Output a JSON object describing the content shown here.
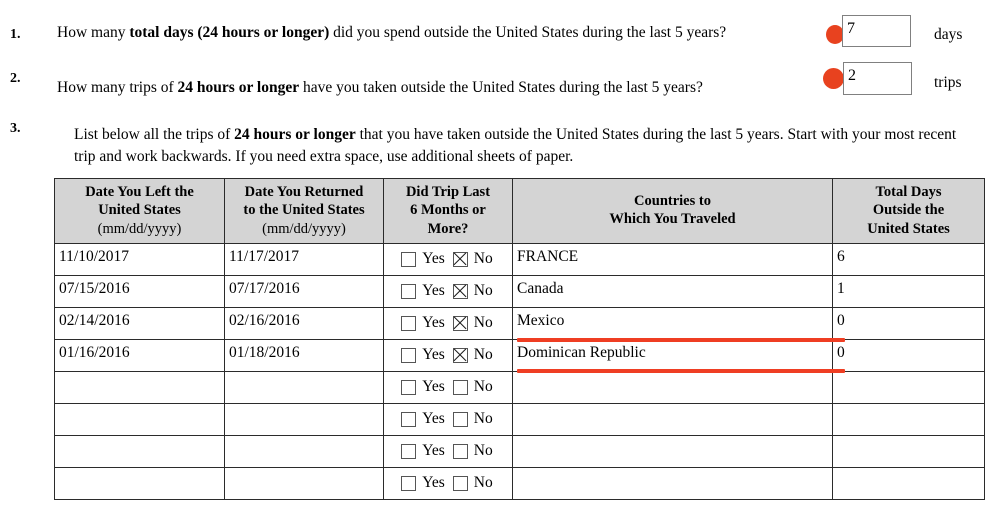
{
  "form": {
    "questions": [
      {
        "number": "1.",
        "text_before": "How many ",
        "text_bold": "total days (24 hours or longer)",
        "text_after": " did you spend outside the United States during the last 5 years?",
        "answer_value": "7",
        "unit": "days"
      },
      {
        "number": "2.",
        "text_before": "How many trips of ",
        "text_bold": "24 hours or longer",
        "text_after": " have you taken outside the United States during the last 5 years?",
        "answer_value": "2",
        "unit": "trips"
      }
    ],
    "item3": {
      "number": "3.",
      "line1_before": "List below all the trips of ",
      "line1_bold": "24 hours or longer",
      "line1_after": " that you have taken outside the United States during the last 5 years. Start with",
      "line2": "your most recent trip and work backwards. If you need extra space, use additional sheets of paper."
    },
    "table": {
      "headers": [
        {
          "line1": "Date You Left the",
          "line2": "United States",
          "line3": "(mm/dd/yyyy)"
        },
        {
          "line1": "Date You Returned",
          "line2": "to the United States",
          "line3": "(mm/dd/yyyy)"
        },
        {
          "line1": "Did Trip Last",
          "line2": "6 Months or",
          "line3": "More?"
        },
        {
          "line1": "Countries to",
          "line2": "Which You Traveled",
          "line3": ""
        },
        {
          "line1": "Total Days",
          "line2": "Outside the",
          "line3": "United States"
        }
      ],
      "yes_label": "Yes",
      "no_label": "No",
      "rows": [
        {
          "date_left": "11/10/2017",
          "date_returned": "11/17/2017",
          "yes_checked": false,
          "no_checked": true,
          "countries": "FRANCE",
          "total_days": "6",
          "highlighted": false
        },
        {
          "date_left": "07/15/2016",
          "date_returned": "07/17/2016",
          "yes_checked": false,
          "no_checked": true,
          "countries": "Canada",
          "total_days": "1",
          "highlighted": false
        },
        {
          "date_left": "02/14/2016",
          "date_returned": "02/16/2016",
          "yes_checked": false,
          "no_checked": true,
          "countries": "Mexico",
          "total_days": "0",
          "highlighted": true
        },
        {
          "date_left": "01/16/2016",
          "date_returned": "01/18/2016",
          "yes_checked": false,
          "no_checked": true,
          "countries": "Dominican Republic",
          "total_days": "0",
          "highlighted": true
        },
        {
          "date_left": "",
          "date_returned": "",
          "yes_checked": false,
          "no_checked": false,
          "countries": "",
          "total_days": "",
          "highlighted": false
        },
        {
          "date_left": "",
          "date_returned": "",
          "yes_checked": false,
          "no_checked": false,
          "countries": "",
          "total_days": "",
          "highlighted": false
        },
        {
          "date_left": "",
          "date_returned": "",
          "yes_checked": false,
          "no_checked": false,
          "countries": "",
          "total_days": "",
          "highlighted": false
        },
        {
          "date_left": "",
          "date_returned": "",
          "yes_checked": false,
          "no_checked": false,
          "countries": "",
          "total_days": "",
          "highlighted": false
        }
      ]
    },
    "annotations": {
      "cursor_color": "#e8421f",
      "highlight_color": "#ef3e23"
    }
  }
}
